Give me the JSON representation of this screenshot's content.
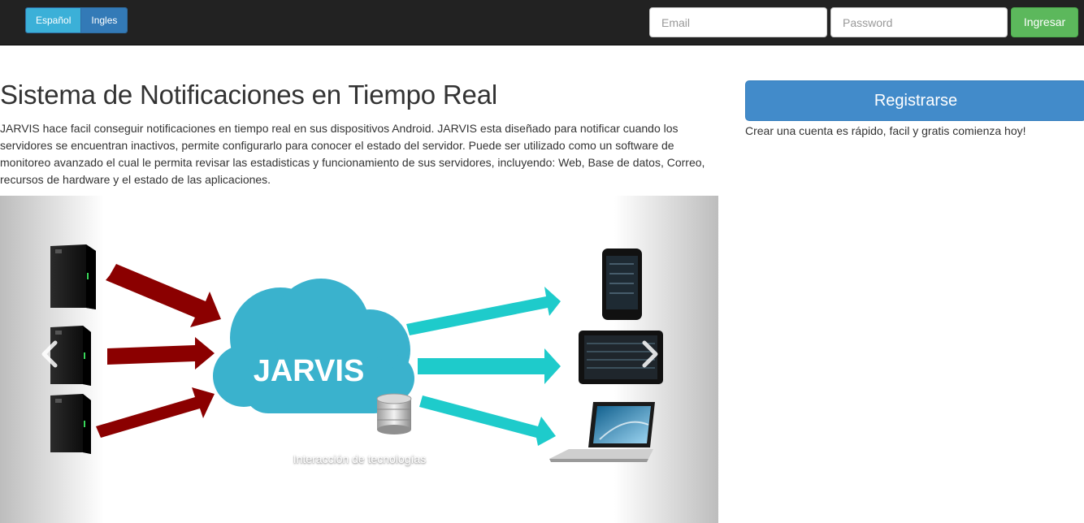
{
  "navbar": {
    "languages": [
      {
        "label": "Español",
        "active": true
      },
      {
        "label": "Ingles",
        "active": false
      }
    ],
    "email_placeholder": "Email",
    "password_placeholder": "Password",
    "login_label": "Ingresar"
  },
  "main": {
    "title": "Sistema de Notificaciones en Tiempo Real",
    "description": "JARVIS hace facil conseguir notificaciones en tiempo real en sus dispositivos Android. JARVIS esta diseñado para notificar cuando los servidores se encuentran inactivos, permite configurarlo para conocer el estado del servidor. Puede ser utilizado como un software de monitoreo avanzado el cual le permita revisar las estadisticas y funcionamiento de sus servidores, incluyendo: Web, Base de datos, Correo, recursos de hardware y el estado de las aplicaciones."
  },
  "carousel": {
    "cloud_label": "JARVIS",
    "caption": "Interacción de tecnologías",
    "prev_icon": "chevron-left-icon",
    "next_icon": "chevron-right-icon"
  },
  "sidebar": {
    "register_label": "Registrarse",
    "register_note": "Crear una cuenta es rápido, facil y gratis comienza hoy!"
  },
  "colors": {
    "navbar_bg": "#222222",
    "lang_active": "#3bb0d8",
    "lang_inactive": "#337ab7",
    "login_btn": "#5cb85c",
    "register_btn": "#428bca",
    "cloud": "#3ab2cd",
    "arrow_in": "#8b0000",
    "arrow_out": "#1ecbcb"
  }
}
